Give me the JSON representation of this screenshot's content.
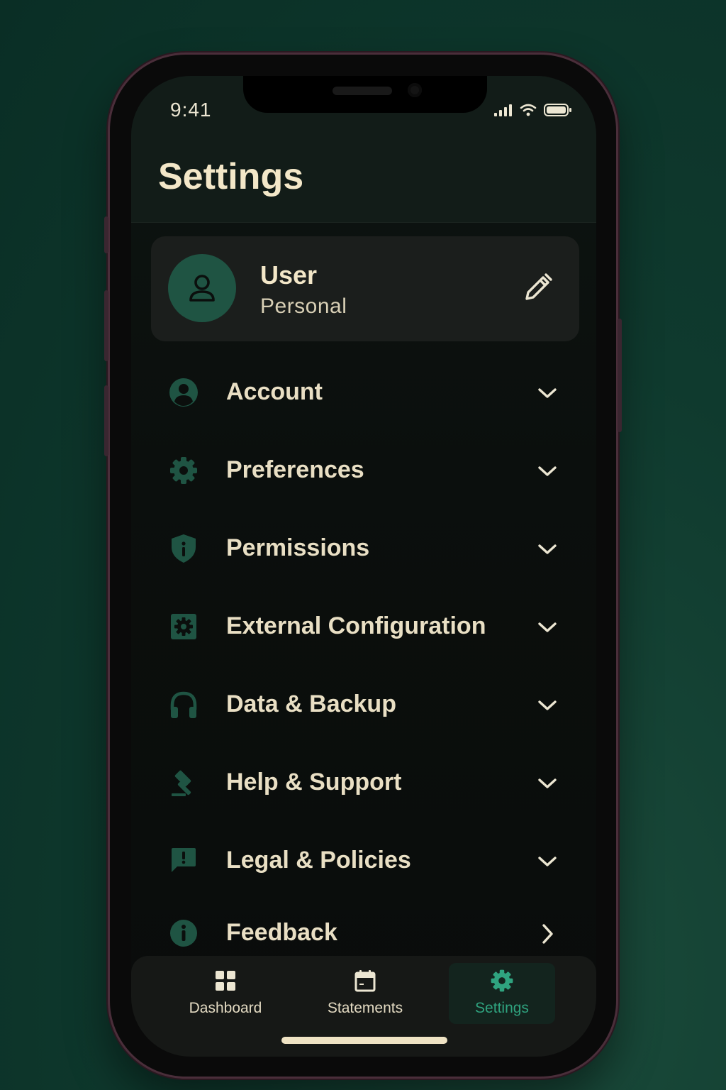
{
  "status_bar": {
    "time": "9:41",
    "icons": [
      "signal-icon",
      "wifi-icon",
      "battery-icon"
    ]
  },
  "header": {
    "title": "Settings"
  },
  "profile": {
    "name": "User",
    "type": "Personal",
    "avatar_icon": "user-icon",
    "edit_icon": "pencil-icon"
  },
  "menu": {
    "items": [
      {
        "label": "Account",
        "icon": "account-circle-icon",
        "chevron": "chevron-down-icon"
      },
      {
        "label": "Preferences",
        "icon": "gear-icon",
        "chevron": "chevron-down-icon"
      },
      {
        "label": "Permissions",
        "icon": "shield-info-icon",
        "chevron": "chevron-down-icon"
      },
      {
        "label": "External Configuration",
        "icon": "settings-box-icon",
        "chevron": "chevron-down-icon"
      },
      {
        "label": "Data & Backup",
        "icon": "headphones-icon",
        "chevron": "chevron-down-icon"
      },
      {
        "label": "Help & Support",
        "icon": "gavel-icon",
        "chevron": "chevron-down-icon"
      },
      {
        "label": "Legal & Policies",
        "icon": "feedback-bubble-icon",
        "chevron": "chevron-down-icon"
      },
      {
        "label": "Feedback",
        "icon": "info-icon",
        "chevron": "chevron-right-icon"
      }
    ]
  },
  "tabbar": {
    "tabs": [
      {
        "label": "Dashboard",
        "icon": "grid-icon",
        "active": false
      },
      {
        "label": "Statements",
        "icon": "calendar-icon",
        "active": false
      },
      {
        "label": "Settings",
        "icon": "gear-icon",
        "active": true
      }
    ]
  },
  "colors": {
    "accent": "#2fa37f",
    "icon_green": "#1f5443",
    "title_cream": "#f3e7c8",
    "background": "#0f3a2e"
  }
}
